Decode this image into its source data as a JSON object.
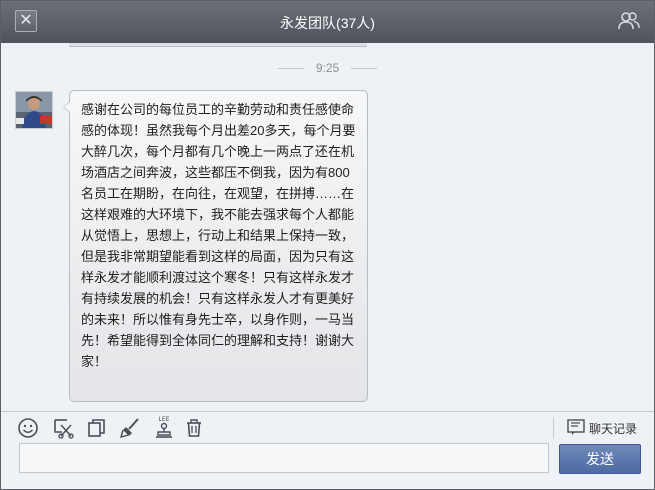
{
  "window": {
    "title": "永发团队(37人)",
    "close_icon": "close-icon",
    "members_icon": "group-members-icon"
  },
  "chat": {
    "timestamp": "9:25",
    "messages": [
      {
        "sender_avatar": "avatar",
        "text": "感谢在公司的每位员工的辛勤劳动和责任感使命感的体现！虽然我每个月出差20多天，每个月要大醉几次，每个月都有几个晚上一两点了还在机场酒店之间奔波，这些都压不倒我，因为有800名员工在期盼，在向往，在观望，在拼搏……在这样艰难的大环境下，我不能去强求每个人都能从觉悟上，思想上，行动上和结果上保持一致，但是我非常期望能看到这样的局面，因为只有这样永发才能顺利渡过这个寒冬！只有这样永发才有持续发展的机会！只有这样永发人才有更美好的未来！所以惟有身先士卒，以身作则，一马当先！希望能得到全体同仁的理解和支持！谢谢大家！"
      }
    ]
  },
  "toolbar": {
    "tools": [
      "smiley-icon",
      "screenshot-scissors-icon",
      "copy-icon",
      "brush-icon",
      "stamp-icon",
      "trash-icon"
    ],
    "stamp_label": "LEE",
    "history_label": "聊天记录"
  },
  "input": {
    "value": "",
    "placeholder": ""
  },
  "send_label": "发送",
  "colors": {
    "titlebar": "#5d6269",
    "chat_bg": "#eef1f5",
    "send_button": "#5a75ab"
  }
}
